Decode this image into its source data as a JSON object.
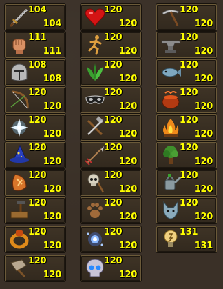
{
  "skills": [
    {
      "id": "attack",
      "current": "104",
      "max": "104",
      "icon": "sword-icon"
    },
    {
      "id": "hitpoints",
      "current": "120",
      "max": "120",
      "icon": "heart-icon"
    },
    {
      "id": "mining",
      "current": "120",
      "max": "120",
      "icon": "pickaxe-icon"
    },
    {
      "id": "strength",
      "current": "111",
      "max": "111",
      "icon": "fist-icon"
    },
    {
      "id": "agility",
      "current": "120",
      "max": "120",
      "icon": "running-man-icon"
    },
    {
      "id": "smithing",
      "current": "120",
      "max": "120",
      "icon": "anvil-icon"
    },
    {
      "id": "defence",
      "current": "108",
      "max": "108",
      "icon": "helmet-icon"
    },
    {
      "id": "herblore",
      "current": "120",
      "max": "120",
      "icon": "herb-leaves-icon"
    },
    {
      "id": "fishing",
      "current": "120",
      "max": "120",
      "icon": "fish-icon"
    },
    {
      "id": "ranged",
      "current": "120",
      "max": "120",
      "icon": "bow-icon"
    },
    {
      "id": "thieving",
      "current": "120",
      "max": "120",
      "icon": "mask-icon"
    },
    {
      "id": "cooking",
      "current": "120",
      "max": "120",
      "icon": "cooking-pot-icon"
    },
    {
      "id": "prayer",
      "current": "120",
      "max": "120",
      "icon": "prayer-star-icon"
    },
    {
      "id": "crafting",
      "current": "120",
      "max": "120",
      "icon": "chisel-hammer-icon"
    },
    {
      "id": "firemaking",
      "current": "120",
      "max": "120",
      "icon": "fire-icon"
    },
    {
      "id": "magic",
      "current": "120",
      "max": "120",
      "icon": "wizard-hat-icon"
    },
    {
      "id": "fletching",
      "current": "120",
      "max": "120",
      "icon": "arrow-icon"
    },
    {
      "id": "woodcutting",
      "current": "120",
      "max": "120",
      "icon": "tree-icon"
    },
    {
      "id": "runecrafting",
      "current": "120",
      "max": "120",
      "icon": "rune-icon"
    },
    {
      "id": "slayer",
      "current": "120",
      "max": "120",
      "icon": "skull-staff-icon"
    },
    {
      "id": "farming",
      "current": "120",
      "max": "120",
      "icon": "watering-can-icon"
    },
    {
      "id": "construction",
      "current": "120",
      "max": "120",
      "icon": "saw-hammer-icon"
    },
    {
      "id": "hunter",
      "current": "120",
      "max": "120",
      "icon": "paw-print-icon"
    },
    {
      "id": "summoning",
      "current": "120",
      "max": "120",
      "icon": "wolf-head-icon"
    },
    {
      "id": "dungeoneering",
      "current": "120",
      "max": "120",
      "icon": "ring-icon"
    },
    {
      "id": "divination",
      "current": "120",
      "max": "120",
      "icon": "wisp-icon"
    },
    {
      "id": "invention",
      "current": "131",
      "max": "131",
      "icon": "lightbulb-icon"
    },
    {
      "id": "archaeology",
      "current": "120",
      "max": "120",
      "icon": "trowel-icon"
    },
    {
      "id": "necromancy",
      "current": "120",
      "max": "120",
      "icon": "skull-icon"
    }
  ],
  "colors": {
    "level_text": "#ffff00",
    "panel_bg": "#3a3027",
    "cell_border": "#6b5a39"
  }
}
